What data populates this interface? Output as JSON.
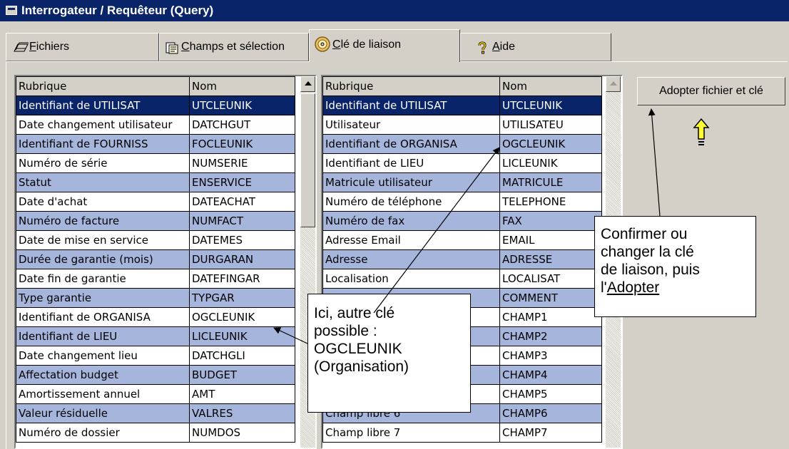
{
  "window": {
    "title": "Interrogateur / Requêteur (Query)"
  },
  "tabs": [
    {
      "accel": "F",
      "rest": "ichiers",
      "icon": "files-icon",
      "active": false
    },
    {
      "accel": "C",
      "rest": "hamps et sélection",
      "icon": "fields-icon",
      "active": false
    },
    {
      "accel": "C",
      "rest": "lé de liaison",
      "icon": "disc-icon",
      "active": true
    },
    {
      "accel": "A",
      "rest": "ide",
      "icon": "help-icon",
      "active": false
    }
  ],
  "left_grid": {
    "headers": [
      "Rubrique",
      "Nom"
    ],
    "rows": [
      [
        "Identifiant de UTILISAT",
        "UTCLEUNIK"
      ],
      [
        "Date changement utilisateur",
        "DATCHGUT"
      ],
      [
        "Identifiant de FOURNISS",
        "FOCLEUNIK"
      ],
      [
        "Numéro de série",
        "NUMSERIE"
      ],
      [
        "Statut",
        "ENSERVICE"
      ],
      [
        "Date d'achat",
        "DATEACHAT"
      ],
      [
        "Numéro de facture",
        "NUMFACT"
      ],
      [
        "Date de mise en service",
        "DATEMES"
      ],
      [
        "Durée de garantie (mois)",
        "DURGARAN"
      ],
      [
        "Date fin de garantie",
        "DATEFINGAR"
      ],
      [
        "Type garantie",
        "TYPGAR"
      ],
      [
        "Identifiant de ORGANISA",
        "OGCLEUNIK"
      ],
      [
        "Identifiant de LIEU",
        "LICLEUNIK"
      ],
      [
        "Date changement lieu",
        "DATCHGLI"
      ],
      [
        "Affectation budget",
        "BUDGET"
      ],
      [
        "Amortissement annuel",
        "AMT"
      ],
      [
        "Valeur résiduelle",
        "VALRES"
      ],
      [
        "Numéro de dossier",
        "NUMDOS"
      ]
    ]
  },
  "right_grid": {
    "headers": [
      "Rubrique",
      "Nom"
    ],
    "rows": [
      [
        "Identifiant de UTILISAT",
        "UTCLEUNIK"
      ],
      [
        "Utilisateur",
        "UTILISATEU"
      ],
      [
        "Identifiant de ORGANISA",
        "OGCLEUNIK"
      ],
      [
        "Identifiant de LIEU",
        "LICLEUNIK"
      ],
      [
        "Matricule utilisateur",
        "MATRICULE"
      ],
      [
        "Numéro de téléphone",
        "TELEPHONE"
      ],
      [
        "Numéro de fax",
        "FAX"
      ],
      [
        "Adresse Email",
        "EMAIL"
      ],
      [
        "Adresse",
        "ADRESSE"
      ],
      [
        "Localisation",
        "LOCALISAT"
      ],
      [
        "",
        "COMMENT"
      ],
      [
        "",
        "CHAMP1"
      ],
      [
        "",
        "CHAMP2"
      ],
      [
        "",
        "CHAMP3"
      ],
      [
        "",
        "CHAMP4"
      ],
      [
        "",
        "CHAMP5"
      ],
      [
        "Champ libre 6",
        "CHAMP6"
      ],
      [
        "Champ libre 7",
        "CHAMP7"
      ]
    ]
  },
  "adopt_button": {
    "label": "Adopter fichier et clé"
  },
  "callout_left": {
    "lines": [
      "Ici, autre clé",
      "possible :",
      "OGCLEUNIK",
      "(Organisation)"
    ]
  },
  "callout_right": {
    "lines": [
      "Confirmer ou",
      "changer la clé",
      "de liaison, puis"
    ],
    "prefix": "l'",
    "link": "Adopter"
  },
  "colors": {
    "title_bar": "#0a246a",
    "row_alt": "#a6b5dc",
    "selection": "#0a246a",
    "arrow_fill": "#ffff33"
  }
}
